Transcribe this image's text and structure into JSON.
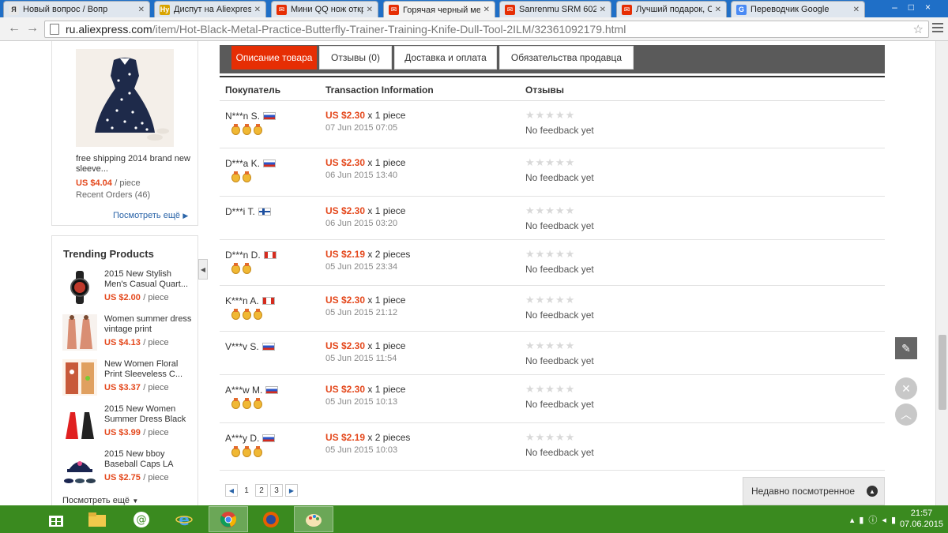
{
  "browser": {
    "tabs": [
      {
        "title": "Новый вопрос / Вопр",
        "fav": "Я",
        "favColor": "#e8e8e8",
        "favText": "#333",
        "active": false
      },
      {
        "title": "Диспут на Aliexpress",
        "fav": "Hy",
        "favColor": "#d9a400",
        "favText": "#fff",
        "active": false
      },
      {
        "title": "Мини QQ нож откры",
        "fav": "✉",
        "favColor": "#e62e04",
        "favText": "#fff",
        "active": false
      },
      {
        "title": "Горячая черный мет",
        "fav": "✉",
        "favColor": "#e62e04",
        "favText": "#fff",
        "active": true
      },
      {
        "title": "Sanrenmu SRM 6029",
        "fav": "✉",
        "favColor": "#e62e04",
        "favText": "#fff",
        "active": false
      },
      {
        "title": "Лучший подарок, Он",
        "fav": "✉",
        "favColor": "#e62e04",
        "favText": "#fff",
        "active": false
      },
      {
        "title": "Переводчик Google",
        "fav": "G",
        "favColor": "#4a8af4",
        "favText": "#fff",
        "active": false
      }
    ],
    "url_host": "ru.aliexpress.com",
    "url_path": "/item/Hot-Black-Metal-Practice-Butterfly-Trainer-Training-Knife-Dull-Tool-2ILM/32361092179.html"
  },
  "sidebar": {
    "featured": {
      "title": "free shipping 2014 brand new sleeve...",
      "price": "US $4.04",
      "per": "/ piece",
      "orders": "Recent Orders (46)",
      "more": "Посмотреть ещё"
    },
    "trending": {
      "title": "Trending Products",
      "more": "Посмотреть ещё",
      "items": [
        {
          "title": "2015 New Stylish Men's Casual Quart...",
          "price": "US $2.00",
          "per": "/ piece"
        },
        {
          "title": "Women summer dress vintage print",
          "price": "US $4.13",
          "per": "/ piece"
        },
        {
          "title": "New Women Floral Print Sleeveless C...",
          "price": "US $3.37",
          "per": "/ piece"
        },
        {
          "title": "2015 New Women Summer Dress Black",
          "price": "US $3.99",
          "per": "/ piece"
        },
        {
          "title": "2015 New bboy Baseball Caps LA",
          "price": "US $2.75",
          "per": "/ piece"
        }
      ]
    }
  },
  "product_tabs": [
    {
      "label": "Описание товара",
      "active": true
    },
    {
      "label": "Отзывы (0)",
      "active": false
    },
    {
      "label": "Доставка и оплата",
      "active": false
    },
    {
      "label": "Обязательства продавца",
      "active": false
    }
  ],
  "table": {
    "headers": {
      "buyer": "Покупатель",
      "txn": "Transaction Information",
      "feedback": "Отзывы"
    },
    "rows": [
      {
        "buyer": "N***n S.",
        "flag": "ru",
        "medals": 3,
        "price": "US $2.30",
        "qty": "x 1 piece",
        "date": "07 Jun 2015 07:05",
        "feedback": "No feedback yet"
      },
      {
        "buyer": "D***a K.",
        "flag": "ru",
        "medals": 2,
        "price": "US $2.30",
        "qty": "x 1 piece",
        "date": "06 Jun 2015 13:40",
        "feedback": "No feedback yet"
      },
      {
        "buyer": "D***i T.",
        "flag": "fi",
        "medals": 0,
        "price": "US $2.30",
        "qty": "x 1 piece",
        "date": "06 Jun 2015 03:20",
        "feedback": "No feedback yet"
      },
      {
        "buyer": "D***n D.",
        "flag": "ca",
        "medals": 2,
        "price": "US $2.19",
        "qty": "x 2 pieces",
        "date": "05 Jun 2015 23:34",
        "feedback": "No feedback yet"
      },
      {
        "buyer": "K***n A.",
        "flag": "ca",
        "medals": 3,
        "price": "US $2.30",
        "qty": "x 1 piece",
        "date": "05 Jun 2015 21:12",
        "feedback": "No feedback yet"
      },
      {
        "buyer": "V***v S.",
        "flag": "ru",
        "medals": 0,
        "price": "US $2.30",
        "qty": "x 1 piece",
        "date": "05 Jun 2015 11:54",
        "feedback": "No feedback yet"
      },
      {
        "buyer": "A***w M.",
        "flag": "ru",
        "medals": 3,
        "price": "US $2.30",
        "qty": "x 1 piece",
        "date": "05 Jun 2015 10:13",
        "feedback": "No feedback yet"
      },
      {
        "buyer": "A***y D.",
        "flag": "ru",
        "medals": 3,
        "price": "US $2.19",
        "qty": "x 2 pieces",
        "date": "05 Jun 2015 10:03",
        "feedback": "No feedback yet"
      }
    ]
  },
  "pager": [
    "1",
    "2",
    "3"
  ],
  "recent_viewed": "Недавно посмотренное",
  "clock": {
    "time": "21:57",
    "date": "07.06.2015"
  },
  "colors": {
    "accent": "#e62e04",
    "price": "#e4481c",
    "taskbar": "#3a8a1f"
  }
}
